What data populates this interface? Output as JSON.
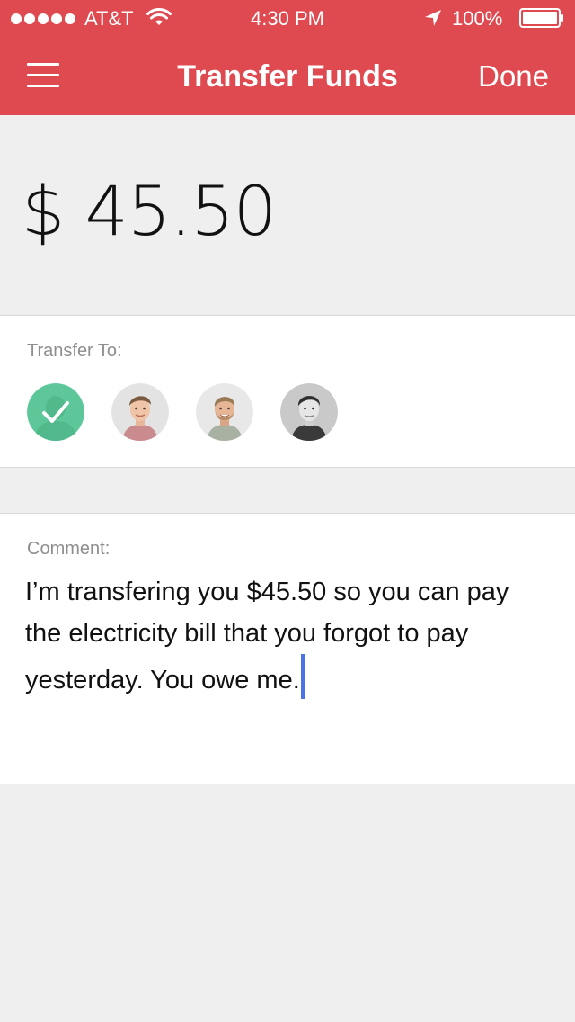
{
  "status_bar": {
    "carrier": "AT&T",
    "time": "4:30 PM",
    "battery": "100%",
    "signal_icon": "signal-dots-icon",
    "wifi_icon": "wifi-icon",
    "location_icon": "location-arrow-icon",
    "battery_icon": "battery-icon"
  },
  "nav": {
    "title": "Transfer Funds",
    "done_label": "Done",
    "menu_icon": "hamburger-menu-icon"
  },
  "amount": {
    "value": "$ 45.50"
  },
  "transfer": {
    "label": "Transfer To:",
    "recipients": [
      {
        "selected": true,
        "icon": "checkmark-icon"
      },
      {
        "selected": false
      },
      {
        "selected": false
      },
      {
        "selected": false
      }
    ]
  },
  "comment": {
    "label": "Comment:",
    "value": "I’m transfering you $45.50 so you can pay the electricity bill that you forgot to pay yesterday. You owe me."
  },
  "colors": {
    "header": "#df4a50",
    "background": "#efefef",
    "selected_recipient": "#5dc79a",
    "cursor": "#4a74e6"
  }
}
